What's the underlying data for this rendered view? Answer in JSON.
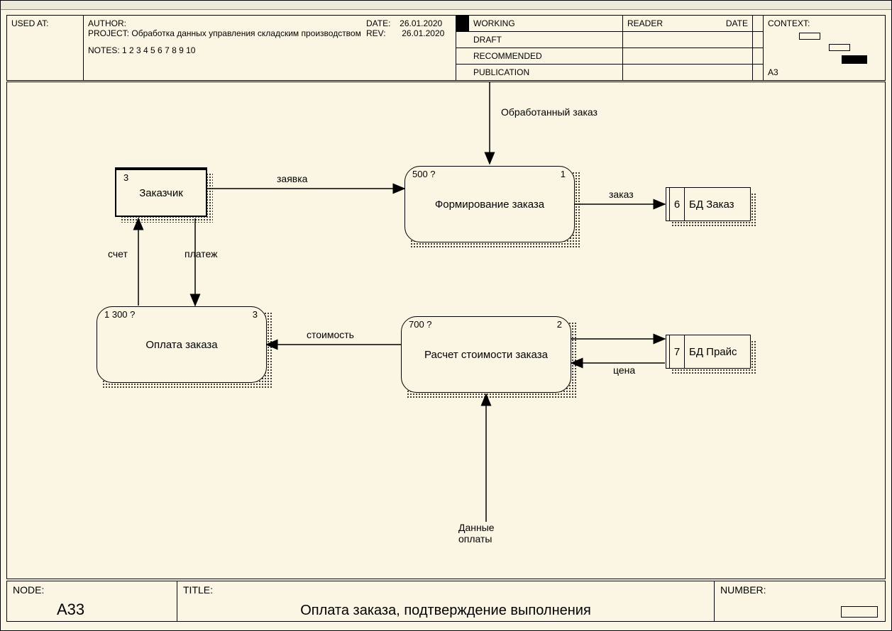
{
  "header": {
    "used_at_label": "USED AT:",
    "author_label": "AUTHOR:",
    "project_label": "PROJECT:",
    "project_value": "Обработка данных управления складским производством",
    "notes_label": "NOTES:",
    "notes_value": "1  2  3  4  5  6  7  8  9  10",
    "date_label": "DATE:",
    "date_value": "26.01.2020",
    "rev_label": "REV:",
    "rev_value": "26.01.2020",
    "status": {
      "working": "WORKING",
      "draft": "DRAFT",
      "recommended": "RECOMMENDED",
      "publication": "PUBLICATION"
    },
    "reader_label": "READER",
    "reader_date_label": "DATE",
    "context_label": "CONTEXT:",
    "context_value": "A3"
  },
  "footer": {
    "node_label": "NODE:",
    "node_value": "A33",
    "title_label": "TITLE:",
    "title_value": "Оплата заказа,  подтверждение выполнения",
    "number_label": "NUMBER:"
  },
  "diagram": {
    "entities": {
      "customer": {
        "id": "3",
        "label": "Заказчик"
      }
    },
    "activities": {
      "form_order": {
        "cost": "500 ?",
        "num": "1",
        "label": "Формирование заказа"
      },
      "calc_cost": {
        "cost": "700 ?",
        "num": "2",
        "label": "Расчет стоимости заказа"
      },
      "pay_order": {
        "cost": "1 300 ?",
        "num": "3",
        "label": "Оплата заказа"
      }
    },
    "datastores": {
      "order_db": {
        "id": "6",
        "label": "БД Заказ"
      },
      "price_db": {
        "id": "7",
        "label": "БД Прайс"
      }
    },
    "flows": {
      "processed_order": "Обработанный заказ",
      "request": "заявка",
      "order": "заказ",
      "invoice": "счет",
      "payment": "платеж",
      "cost": "стоимость",
      "price": "цена",
      "payment_data_l1": "Данные",
      "payment_data_l2": "оплаты"
    }
  }
}
